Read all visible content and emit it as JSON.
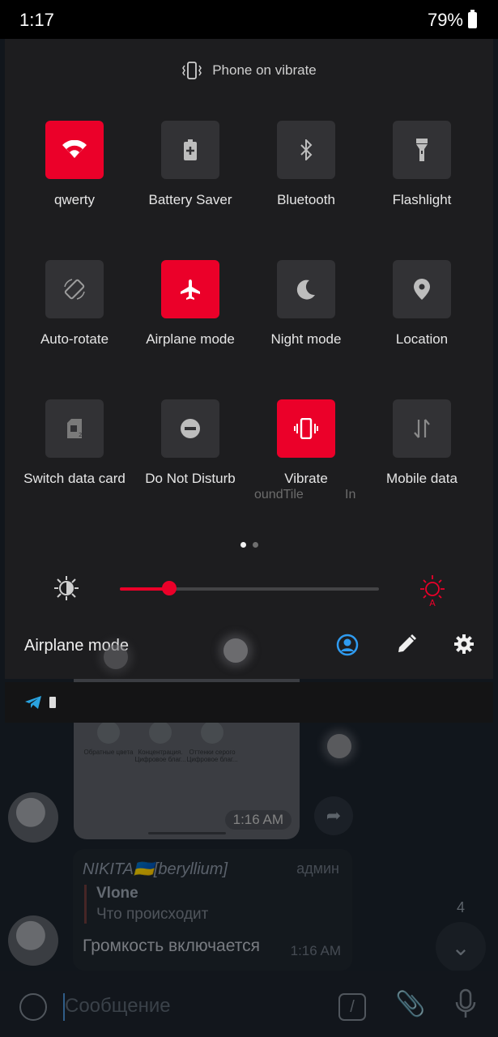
{
  "status_bar": {
    "time": "1:17",
    "battery": "79%"
  },
  "quick_settings": {
    "header": "Phone on vibrate",
    "tiles": [
      {
        "label": "qwerty",
        "icon": "wifi-icon",
        "active": true
      },
      {
        "label": "Battery Saver",
        "icon": "battery-saver-icon",
        "active": false
      },
      {
        "label": "Bluetooth",
        "icon": "bluetooth-icon",
        "active": false
      },
      {
        "label": "Flashlight",
        "icon": "flashlight-icon",
        "active": false
      },
      {
        "label": "Auto-rotate",
        "icon": "auto-rotate-icon",
        "active": false
      },
      {
        "label": "Airplane mode",
        "icon": "airplane-icon",
        "active": true
      },
      {
        "label": "Night mode",
        "icon": "moon-icon",
        "active": false
      },
      {
        "label": "Location",
        "icon": "location-pin-icon",
        "active": false
      },
      {
        "label": "Switch data card",
        "icon": "sim-card-icon",
        "active": false
      },
      {
        "label": "Do Not Disturb",
        "icon": "do-not-disturb-icon",
        "active": false
      },
      {
        "label": "Vibrate",
        "icon": "vibrate-icon",
        "active": true
      },
      {
        "label": "Mobile data",
        "icon": "mobile-data-icon",
        "active": false
      }
    ],
    "ghost_texts": [
      "oundTile",
      "In"
    ],
    "page_dots": {
      "count": 2,
      "current": 1
    },
    "brightness": {
      "level": 0.19
    },
    "footer_title": "Airplane mode",
    "accent_color": "#eb0029"
  },
  "chat": {
    "media_labels": [
      "Обратные цвета",
      "Концентрация.",
      "Оттенки серого"
    ],
    "media_sublabels": [
      "",
      "Цифровое благ...",
      "Цифровое благ..."
    ],
    "media_time": "1:16 AM",
    "message": {
      "author": "NIKITA🇺🇦[beryllium]",
      "role": "админ",
      "quote_name": "Vlone",
      "quote_text": "Что происходит",
      "text": "Громкость включается",
      "time": "1:16 AM"
    },
    "unread_count": "4",
    "input_placeholder": "Сообщение"
  }
}
